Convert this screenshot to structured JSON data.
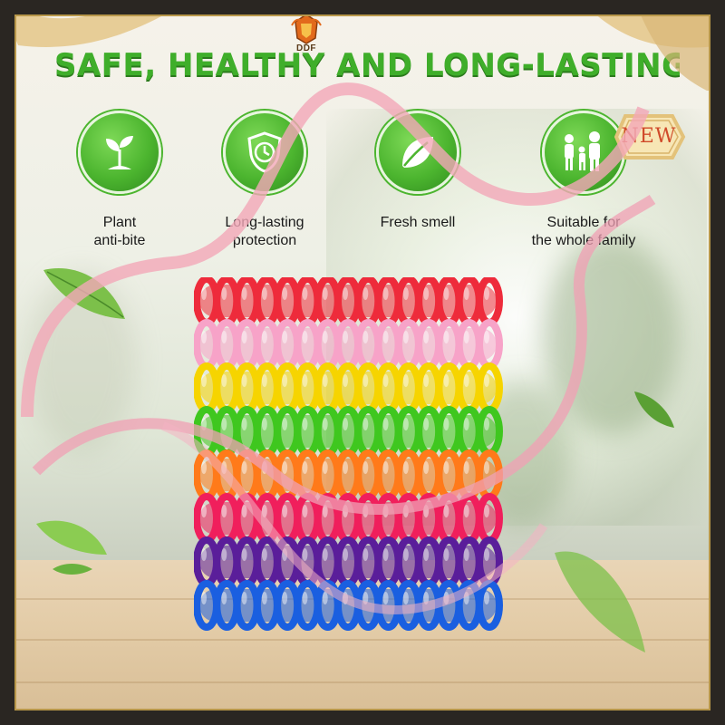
{
  "brand": {
    "logo_text": "DDF"
  },
  "headline": "SAFE, HEALTHY AND LONG-LASTING",
  "badge": "NEW",
  "features": [
    {
      "icon": "sprout-icon",
      "label_line1": "Plant",
      "label_line2": "anti-bite"
    },
    {
      "icon": "shield-clock-icon",
      "label_line1": "Long-lasting",
      "label_line2": "protection"
    },
    {
      "icon": "leaf-icon",
      "label_line1": "Fresh smell",
      "label_line2": ""
    },
    {
      "icon": "family-icon",
      "label_line1": "Suitable for",
      "label_line2": "the whole family"
    }
  ],
  "colors": {
    "headline_green": "#3fae2a",
    "icon_green": "#4cb52f",
    "frame_dark": "#2a2622",
    "frame_gold": "#b8974a",
    "ribbon_pink": "#f2a7b8",
    "badge_gold": "#e3c27a",
    "badge_text": "#d04a2a"
  },
  "product": {
    "bracelet_colors": [
      "#ee2b3b",
      "#f7a3c8",
      "#f6d400",
      "#3fc71f",
      "#ff7a1a",
      "#f01f5c",
      "#5a1e9a",
      "#1a5fe0"
    ]
  }
}
